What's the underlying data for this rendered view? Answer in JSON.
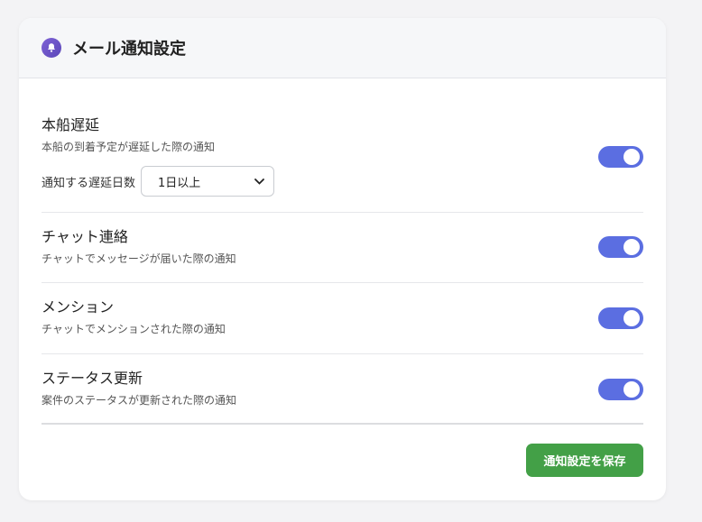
{
  "header": {
    "title": "メール通知設定",
    "icon": "bell-icon"
  },
  "settings": [
    {
      "title": "本船遅延",
      "description": "本船の到着予定が遅延した際の通知",
      "enabled": true,
      "delay_label": "通知する遅延日数",
      "delay_value": "1日以上"
    },
    {
      "title": "チャット連絡",
      "description": "チャットでメッセージが届いた際の通知",
      "enabled": true
    },
    {
      "title": "メンション",
      "description": "チャットでメンションされた際の通知",
      "enabled": true
    },
    {
      "title": "ステータス更新",
      "description": "案件のステータスが更新された際の通知",
      "enabled": true
    }
  ],
  "footer": {
    "save_label": "通知設定を保存"
  },
  "colors": {
    "toggle_on": "#5b6ee1",
    "save_button": "#43a047",
    "bell_icon": "#6a52c6"
  }
}
